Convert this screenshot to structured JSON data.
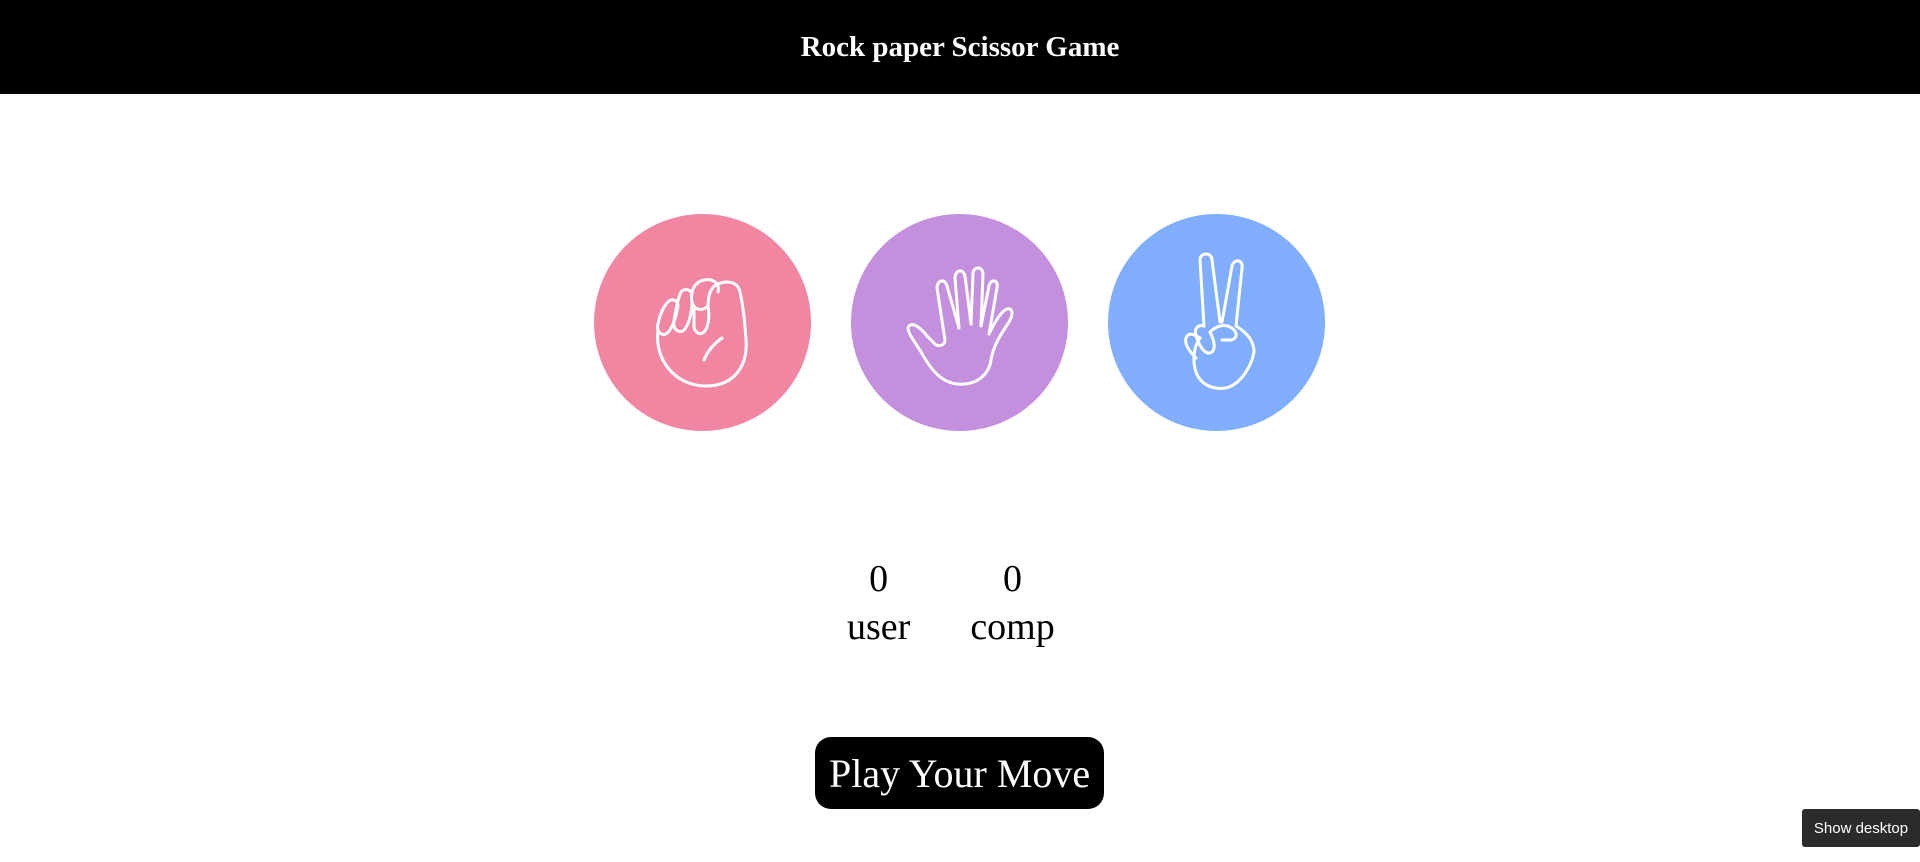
{
  "header": {
    "title": "Rock paper Scissor Game"
  },
  "choices": [
    {
      "id": "rock",
      "icon": "rock-fist-icon",
      "color": "#f086a2"
    },
    {
      "id": "paper",
      "icon": "paper-hand-icon",
      "color": "#c490de"
    },
    {
      "id": "scissors",
      "icon": "scissors-hand-icon",
      "color": "#80aefc"
    }
  ],
  "scores": {
    "user": {
      "value": "0",
      "label": "user"
    },
    "comp": {
      "value": "0",
      "label": "comp"
    }
  },
  "message": {
    "label": "Play Your Move"
  },
  "taskbar": {
    "show_desktop_label": "Show desktop"
  },
  "colors": {
    "header_bg": "#000000",
    "message_bg": "#000000"
  }
}
